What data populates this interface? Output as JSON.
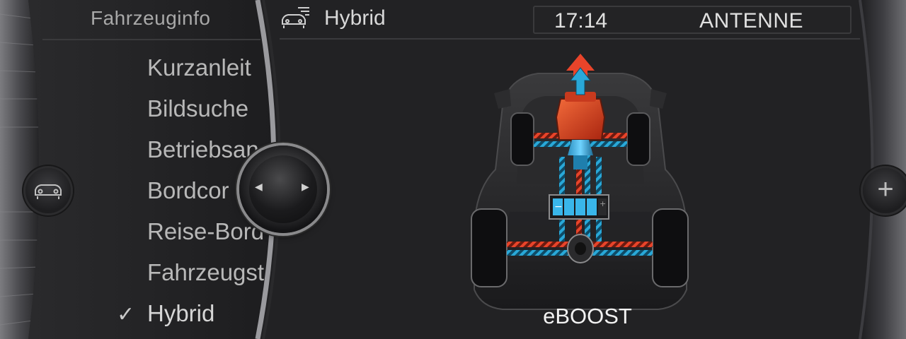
{
  "menu": {
    "title": "Fahrzeuginfo",
    "items": [
      {
        "label": "Kurzanleit"
      },
      {
        "label": "Bildsuche"
      },
      {
        "label": "Betriebsan"
      },
      {
        "label": "Bordcor"
      },
      {
        "label": "Reise-Bord"
      },
      {
        "label": "Fahrzeugst"
      },
      {
        "label": "Hybrid"
      }
    ],
    "checkmark": "✓"
  },
  "header": {
    "title": "Hybrid",
    "icon": "car-info-icon"
  },
  "status": {
    "time": "17:14",
    "source": "ANTENNE"
  },
  "diagram": {
    "mode": "eBOOST",
    "engine_flow_color": "#e8442a",
    "electric_flow_color": "#29a8d8",
    "battery_segments_filled": 4,
    "battery_segments_total": 5
  },
  "controls": {
    "left_button_icon": "car-icon",
    "right_button_icon": "plus-icon",
    "plus_symbol": "+",
    "knob_left_arrow": "◀",
    "knob_right_arrow": "▶"
  }
}
